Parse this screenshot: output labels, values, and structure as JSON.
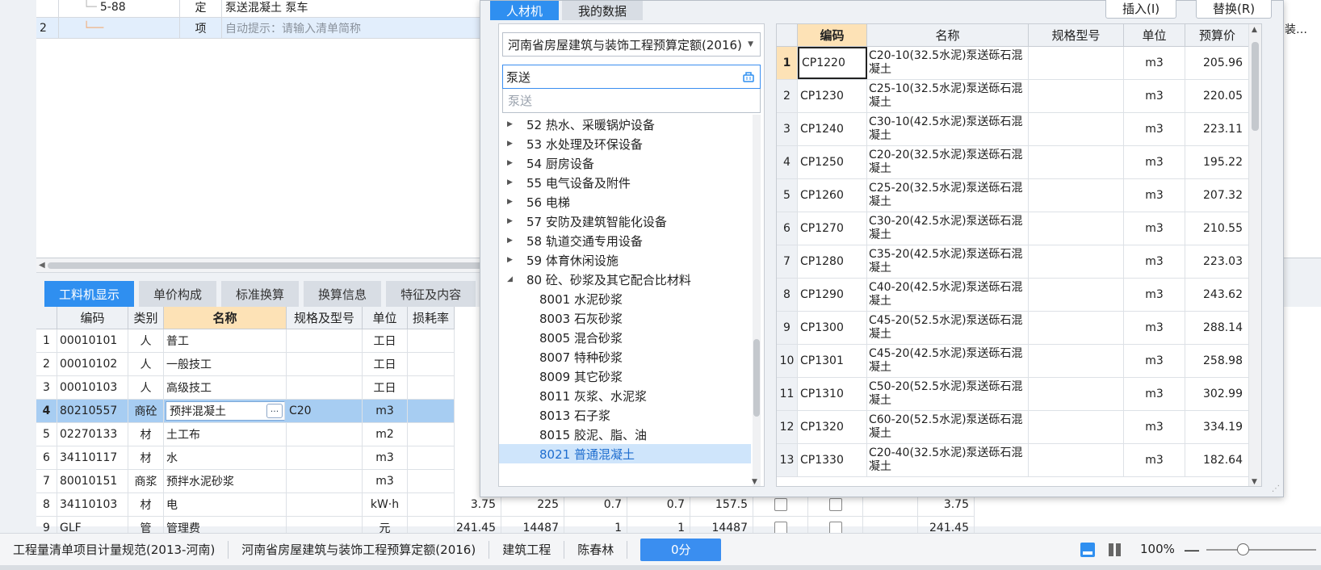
{
  "top_grid": {
    "rows": [
      {
        "num": "",
        "code": "5-88",
        "type": "定",
        "name": "泵送混凝土 泵车"
      },
      {
        "num": "2",
        "code": "",
        "type": "项",
        "name": "自动提示：请输入清单简称"
      }
    ],
    "right_edge_text": "装…"
  },
  "bottom_tabs": [
    "工料机显示",
    "单价构成",
    "标准换算",
    "换算信息",
    "特征及内容"
  ],
  "bottom_grid": {
    "headers": [
      "编码",
      "类别",
      "名称",
      "规格及型号",
      "单位",
      "损耗率"
    ],
    "rows": [
      {
        "num": "1",
        "code": "00010101",
        "type": "人",
        "name": "普工",
        "spec": "",
        "unit": "工日",
        "extra": []
      },
      {
        "num": "2",
        "code": "00010102",
        "type": "人",
        "name": "一般技工",
        "spec": "",
        "unit": "工日",
        "extra": []
      },
      {
        "num": "3",
        "code": "00010103",
        "type": "人",
        "name": "高级技工",
        "spec": "",
        "unit": "工日",
        "extra": []
      },
      {
        "num": "4",
        "code": "80210557",
        "type": "商砼",
        "name": "预拌混凝土",
        "spec": "C20",
        "unit": "m3",
        "extra": []
      },
      {
        "num": "5",
        "code": "02270133",
        "type": "材",
        "name": "土工布",
        "spec": "",
        "unit": "m2",
        "extra": []
      },
      {
        "num": "6",
        "code": "34110117",
        "type": "材",
        "name": "水",
        "spec": "",
        "unit": "m3",
        "extra": []
      },
      {
        "num": "7",
        "code": "80010151",
        "type": "商浆",
        "name": "预拌水泥砂浆",
        "spec": "",
        "unit": "m3",
        "extra": []
      },
      {
        "num": "8",
        "code": "34110103",
        "type": "材",
        "name": "电",
        "spec": "",
        "unit": "kW·h",
        "extra": [
          "3.75",
          "225",
          "0.7",
          "0.7",
          "157.5",
          "3.75"
        ]
      },
      {
        "num": "9",
        "code": "GLF",
        "type": "管",
        "name": "管理费",
        "spec": "",
        "unit": "元",
        "extra": [
          "241.45",
          "14487",
          "1",
          "1",
          "14487",
          "241.45"
        ]
      }
    ]
  },
  "status_bar": {
    "items": [
      "工程量清单项目计量规范(2013-河南)",
      "河南省房屋建筑与装饰工程预算定额(2016)",
      "建筑工程",
      "陈春林"
    ],
    "score": "0分",
    "zoom": "100%",
    "zoom_minus": "—"
  },
  "dialog": {
    "tabs": [
      "人材机",
      "我的数据"
    ],
    "insert_label": "插入(I)",
    "replace_label": "替换(R)",
    "quota_select": "河南省房屋建筑与装饰工程预算定额(2016)",
    "search_value": "泵送",
    "suggestion": "泵送",
    "tree": [
      {
        "label": "52 热水、采暖锅炉设备",
        "level": 0,
        "arrow": "▶"
      },
      {
        "label": "53 水处理及环保设备",
        "level": 0,
        "arrow": "▶"
      },
      {
        "label": "54 厨房设备",
        "level": 0,
        "arrow": "▶"
      },
      {
        "label": "55 电气设备及附件",
        "level": 0,
        "arrow": "▶"
      },
      {
        "label": "56 电梯",
        "level": 0,
        "arrow": "▶"
      },
      {
        "label": "57 安防及建筑智能化设备",
        "level": 0,
        "arrow": "▶"
      },
      {
        "label": "58 轨道交通专用设备",
        "level": 0,
        "arrow": "▶"
      },
      {
        "label": "59 体育休闲设施",
        "level": 0,
        "arrow": "▶"
      },
      {
        "label": "80 砼、砂浆及其它配合比材料",
        "level": 0,
        "arrow": "◢"
      },
      {
        "label": "8001 水泥砂浆",
        "level": 1,
        "arrow": ""
      },
      {
        "label": "8003 石灰砂浆",
        "level": 1,
        "arrow": ""
      },
      {
        "label": "8005 混合砂浆",
        "level": 1,
        "arrow": ""
      },
      {
        "label": "8007 特种砂浆",
        "level": 1,
        "arrow": ""
      },
      {
        "label": "8009 其它砂浆",
        "level": 1,
        "arrow": ""
      },
      {
        "label": "8011 灰浆、水泥浆",
        "level": 1,
        "arrow": ""
      },
      {
        "label": "8013 石子浆",
        "level": 1,
        "arrow": ""
      },
      {
        "label": "8015 胶泥、脂、油",
        "level": 1,
        "arrow": ""
      },
      {
        "label": "8021 普通混凝土",
        "level": 1,
        "arrow": ""
      }
    ],
    "result_headers": [
      "编码",
      "名称",
      "规格型号",
      "单位",
      "预算价"
    ],
    "results": [
      {
        "num": "1",
        "code": "CP1220",
        "name": "C20-10(32.5水泥)泵送砾石混凝土",
        "spec": "",
        "unit": "m3",
        "price": "205.96"
      },
      {
        "num": "2",
        "code": "CP1230",
        "name": "C25-10(32.5水泥)泵送砾石混凝土",
        "spec": "",
        "unit": "m3",
        "price": "220.05"
      },
      {
        "num": "3",
        "code": "CP1240",
        "name": "C30-10(42.5水泥)泵送砾石混凝土",
        "spec": "",
        "unit": "m3",
        "price": "223.11"
      },
      {
        "num": "4",
        "code": "CP1250",
        "name": "C20-20(32.5水泥)泵送砾石混凝土",
        "spec": "",
        "unit": "m3",
        "price": "195.22"
      },
      {
        "num": "5",
        "code": "CP1260",
        "name": "C25-20(32.5水泥)泵送砾石混凝土",
        "spec": "",
        "unit": "m3",
        "price": "207.32"
      },
      {
        "num": "6",
        "code": "CP1270",
        "name": "C30-20(42.5水泥)泵送砾石混凝土",
        "spec": "",
        "unit": "m3",
        "price": "210.55"
      },
      {
        "num": "7",
        "code": "CP1280",
        "name": "C35-20(42.5水泥)泵送砾石混凝土",
        "spec": "",
        "unit": "m3",
        "price": "223.03"
      },
      {
        "num": "8",
        "code": "CP1290",
        "name": "C40-20(42.5水泥)泵送砾石混凝土",
        "spec": "",
        "unit": "m3",
        "price": "243.62"
      },
      {
        "num": "9",
        "code": "CP1300",
        "name": "C45-20(52.5水泥)泵送砾石混凝土",
        "spec": "",
        "unit": "m3",
        "price": "288.14"
      },
      {
        "num": "10",
        "code": "CP1301",
        "name": "C45-20(42.5水泥)泵送砾石混凝土",
        "spec": "",
        "unit": "m3",
        "price": "258.98"
      },
      {
        "num": "11",
        "code": "CP1310",
        "name": "C50-20(52.5水泥)泵送砾石混凝土",
        "spec": "",
        "unit": "m3",
        "price": "302.99"
      },
      {
        "num": "12",
        "code": "CP1320",
        "name": "C60-20(52.5水泥)泵送砾石混凝土",
        "spec": "",
        "unit": "m3",
        "price": "334.19"
      },
      {
        "num": "13",
        "code": "CP1330",
        "name": "C20-40(32.5水泥)泵送砾石混凝土",
        "spec": "",
        "unit": "m3",
        "price": "182.64"
      }
    ]
  },
  "colors": {
    "accent": "#2f8ff0",
    "header_highlight": "#fde2b6",
    "selected_row": "#a7cdf2"
  }
}
